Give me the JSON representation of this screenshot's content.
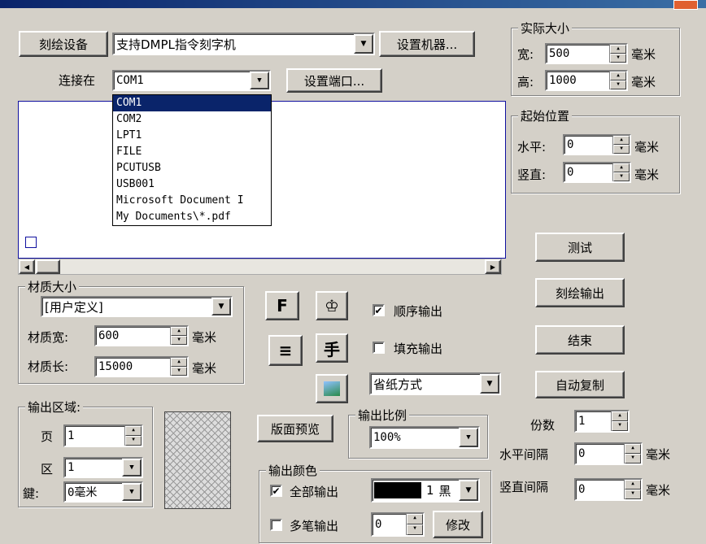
{
  "device": {
    "label": "刻绘设备",
    "machine": "支持DMPL指令刻字机",
    "setup_machine": "设置机器..."
  },
  "port": {
    "label": "连接在",
    "value": "COM1",
    "setup_port": "设置端口...",
    "options": [
      "COM1",
      "COM2",
      "LPT1",
      "FILE",
      "PCUTUSB",
      "USB001",
      "Microsoft Document I",
      "My Documents\\*.pdf"
    ]
  },
  "actual_size": {
    "title": "实际大小",
    "width_label": "宽:",
    "width": "500",
    "height_label": "高:",
    "height": "1000",
    "unit": "毫米"
  },
  "start_pos": {
    "title": "起始位置",
    "h_label": "水平:",
    "h": "0",
    "v_label": "竖直:",
    "v": "0",
    "unit": "毫米"
  },
  "material": {
    "title": "材质大小",
    "preset": "[用户定义]",
    "width_label": "材质宽:",
    "width": "600",
    "length_label": "材质长:",
    "length": "15000",
    "unit": "毫米"
  },
  "icons": {
    "f_glyph": "F",
    "lines_glyph": "≡",
    "person_glyph": "♔",
    "char_glyph": "手"
  },
  "options": {
    "sequential": "顺序输出",
    "sequential_checked": "✔",
    "fill": "填充输出",
    "paper_mode": "省纸方式"
  },
  "output_area": {
    "title": "输出区域:",
    "page_label": "页",
    "page": "1",
    "zone_label": "区",
    "zone": "1",
    "gap_label": "鍵:",
    "gap": "0毫米"
  },
  "preview": {
    "label": "版面预览"
  },
  "ratio": {
    "title": "输出比例",
    "value": "100%"
  },
  "color": {
    "title": "输出颜色",
    "all": "全部输出",
    "all_checked": "✔",
    "pen_value": "1",
    "pen_color": "黑",
    "multi": "多笔输出",
    "multi_value": "0",
    "modify": "修改",
    "swatch": "#000000"
  },
  "buttons": {
    "test": "测试",
    "output": "刻绘输出",
    "end": "结束",
    "auto_copy": "自动复制"
  },
  "copies": {
    "label": "份数",
    "value": "1",
    "h_gap_label": "水平间隔",
    "h_gap": "0",
    "v_gap_label": "竖直间隔",
    "v_gap": "0",
    "unit": "毫米"
  },
  "colors": {
    "face": "#d4d0c8",
    "selection": "#0a246a",
    "list_border": "#1010a0"
  }
}
